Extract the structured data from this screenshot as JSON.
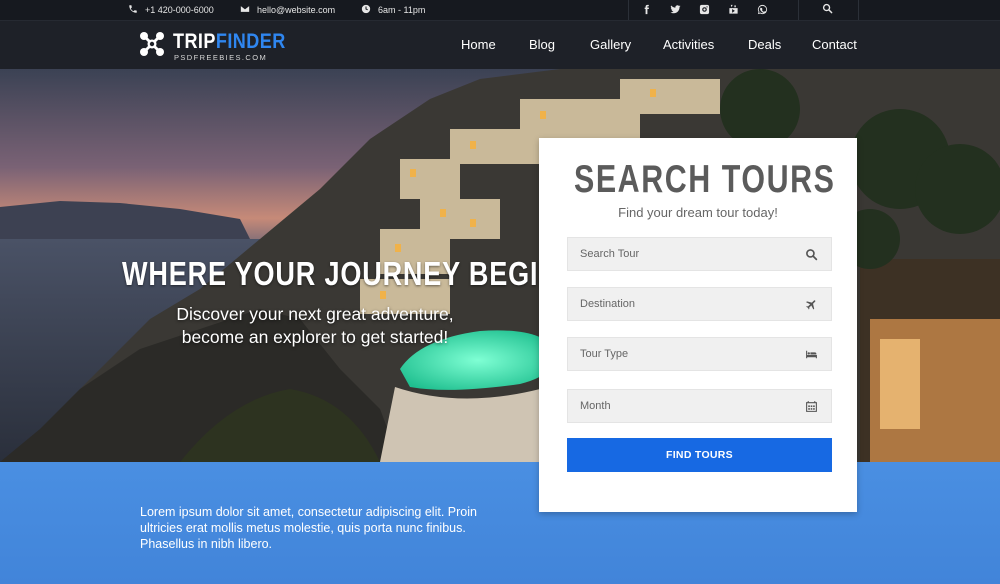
{
  "topbar": {
    "phone": "+1 420-000-6000",
    "email": "hello@website.com",
    "hours": "6am - 11pm",
    "social_icons": [
      "facebook-icon",
      "twitter-icon",
      "instagram-icon",
      "youtube-icon",
      "whatsapp-icon"
    ]
  },
  "brand": {
    "name_part1": "TRIP",
    "name_part2": "FINDER",
    "tagline": "PSDFREEBIES.COM",
    "accent_color": "#2f86f0"
  },
  "nav": {
    "items": [
      {
        "label": "Home"
      },
      {
        "label": "Blog"
      },
      {
        "label": "Gallery"
      },
      {
        "label": "Activities"
      },
      {
        "label": "Deals"
      },
      {
        "label": "Contact"
      }
    ]
  },
  "hero": {
    "title": "WHERE YOUR JOURNEY BEGINS.",
    "subtitle_line1": "Discover your next great adventure,",
    "subtitle_line2": "become an explorer to get started!"
  },
  "search_card": {
    "title": "SEARCH TOURS",
    "subtitle": "Find your dream tour today!",
    "fields": [
      {
        "placeholder": "Search Tour",
        "icon": "search-icon"
      },
      {
        "placeholder": "Destination",
        "icon": "plane-icon"
      },
      {
        "placeholder": "Tour Type",
        "icon": "bed-icon"
      },
      {
        "placeholder": "Month",
        "icon": "calendar-icon"
      }
    ],
    "button_label": "FIND TOURS",
    "button_color": "#1769e3"
  },
  "band": {
    "text": "Lorem ipsum dolor sit amet, consectetur adipiscing elit. Proin ultricies erat mollis metus molestie, quis porta nunc finibus. Phasellus in nibh libero.",
    "color": "#4a8fe2"
  }
}
